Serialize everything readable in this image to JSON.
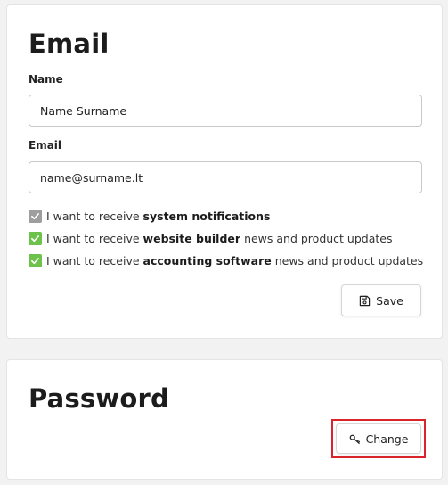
{
  "email_section": {
    "title": "Email",
    "name_label": "Name",
    "name_value": "Name Surname",
    "email_label": "Email",
    "email_value": "name@surname.lt",
    "checkboxes": [
      {
        "prefix": "I want to receive",
        "bold": "system notifications",
        "suffix": "",
        "checked": true,
        "color": "#9e9e9e"
      },
      {
        "prefix": "I want to receive",
        "bold": "website builder",
        "suffix": "news and product updates",
        "checked": true,
        "color": "#6cc24a"
      },
      {
        "prefix": "I want to receive",
        "bold": "accounting software",
        "suffix": "news and product updates",
        "checked": true,
        "color": "#6cc24a"
      }
    ],
    "save_label": "Save",
    "save_icon": "floppy-disk-icon"
  },
  "password_section": {
    "title": "Password",
    "change_label": "Change",
    "change_icon": "key-icon"
  },
  "colors": {
    "highlight": "#d9242b",
    "check_gray": "#9e9e9e",
    "check_green": "#6cc24a"
  }
}
